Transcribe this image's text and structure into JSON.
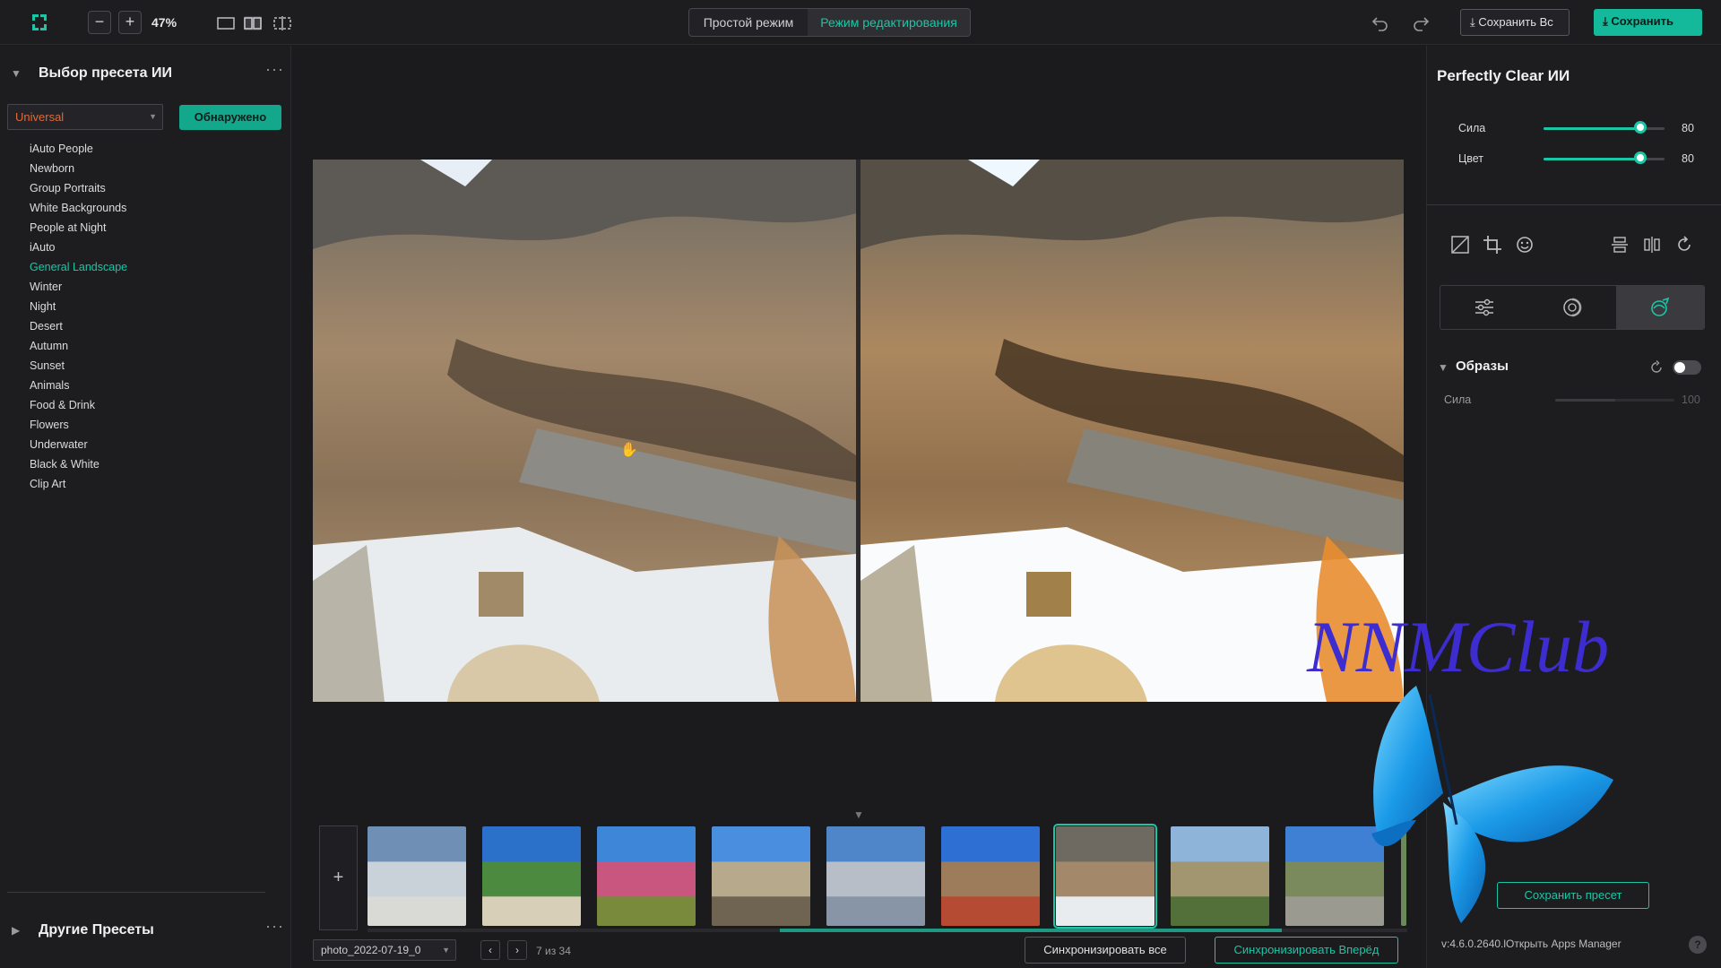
{
  "toolbar": {
    "zoom_out_label": "−",
    "zoom_in_label": "+",
    "zoom_value": "47%",
    "mode_simple": "Простой режим",
    "mode_edit": "Режим редактирования",
    "save_all_label": "Сохранить Вс",
    "save_label": "Сохранить"
  },
  "presets": {
    "section_title": "Выбор пресета ИИ",
    "selected": "Universal",
    "detected_label": "Обнаружено",
    "items": [
      "iAuto People",
      "Newborn",
      "Group Portraits",
      "White Backgrounds",
      "People at Night",
      "iAuto",
      "General Landscape",
      "Winter",
      "Night",
      "Desert",
      "Autumn",
      "Sunset",
      "Animals",
      "Food & Drink",
      "Flowers",
      "Underwater",
      "Black & White",
      "Clip Art"
    ],
    "active_item": "General Landscape",
    "other_title": "Другие Пресеты"
  },
  "filmstrip": {
    "add_label": "+",
    "filename": "photo_2022-07-19_0",
    "counter": "7 из 34",
    "sync_all": "Синхронизировать все",
    "sync_forward": "Синхронизировать Вперёд",
    "selected_index": 6
  },
  "adjust": {
    "title": "Perfectly Clear ИИ",
    "sliders": [
      {
        "label": "Сила",
        "value": "80",
        "fraction": 0.8
      },
      {
        "label": "Цвет",
        "value": "80",
        "fraction": 0.8
      }
    ]
  },
  "looks": {
    "title": "Образы",
    "strength_label": "Сила",
    "strength_value": "100",
    "strength_fraction": 0.5,
    "enabled": false
  },
  "footer": {
    "save_preset": "Сохранить пресет",
    "version": "v:4.6.0.2640.lОткрыть Apps Manager",
    "help": "?"
  },
  "watermark": "NNMClub",
  "colors": {
    "accent": "#19c7a6",
    "preset_selected": "#e06a38",
    "background": "#1b1b1e"
  }
}
